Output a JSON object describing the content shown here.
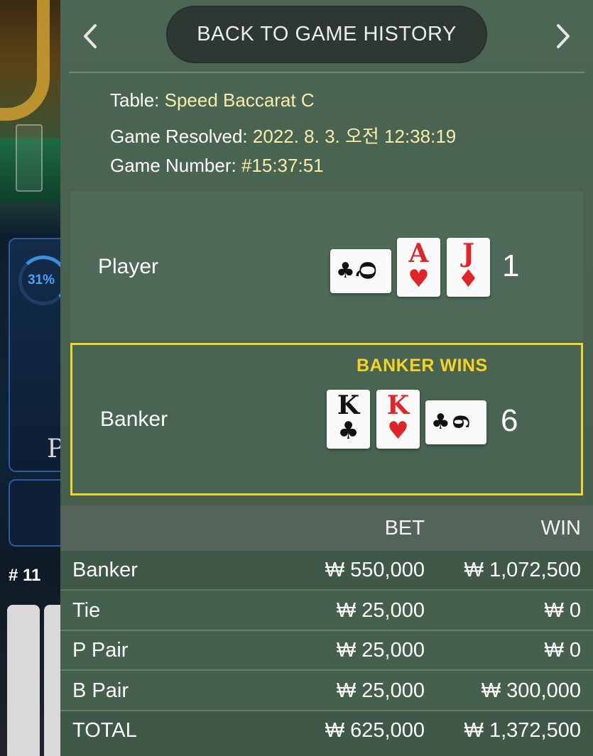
{
  "background": {
    "timer_percent": "31%",
    "player_panel_text": "P",
    "round_number": "# 11"
  },
  "header": {
    "back_label": "BACK TO GAME HISTORY",
    "prev_icon": "chevron-left-icon",
    "next_icon": "chevron-right-icon"
  },
  "info": {
    "table_label": "Table: ",
    "table_value": "Speed Baccarat C",
    "resolved_label": "Game Resolved: ",
    "resolved_value": "2022. 8. 3. 오전 12:38:19",
    "number_label": "Game Number: ",
    "number_value": "#15:37:51"
  },
  "player_hand": {
    "label": "Player",
    "score": "1",
    "cards": [
      {
        "rank": "Q",
        "suit": "♣",
        "color": "black",
        "orientation": "sideways"
      },
      {
        "rank": "A",
        "suit": "♥",
        "color": "red",
        "orientation": "upright"
      },
      {
        "rank": "J",
        "suit": "♦",
        "color": "red",
        "orientation": "upright"
      }
    ]
  },
  "banker_hand": {
    "label": "Banker",
    "score": "6",
    "result": "BANKER WINS",
    "cards": [
      {
        "rank": "K",
        "suit": "♣",
        "color": "black",
        "orientation": "upright"
      },
      {
        "rank": "K",
        "suit": "♥",
        "color": "red",
        "orientation": "upright"
      },
      {
        "rank": "6",
        "suit": "♣",
        "color": "black",
        "orientation": "sideways"
      }
    ]
  },
  "bets": {
    "header_bet": "BET",
    "header_win": "WIN",
    "rows": [
      {
        "label": "Banker",
        "bet": "₩ 550,000",
        "win": "₩ 1,072,500"
      },
      {
        "label": "Tie",
        "bet": "₩ 25,000",
        "win": "₩ 0"
      },
      {
        "label": "P Pair",
        "bet": "₩ 25,000",
        "win": "₩ 0"
      },
      {
        "label": "B Pair",
        "bet": "₩ 25,000",
        "win": "₩ 300,000"
      }
    ],
    "total": {
      "label": "TOTAL",
      "bet": "₩ 625,000",
      "win": "₩ 1,372,500"
    }
  },
  "colors": {
    "accent_yellow": "#f5d322",
    "info_value": "#f6ecae",
    "card_red": "#e0242a"
  }
}
